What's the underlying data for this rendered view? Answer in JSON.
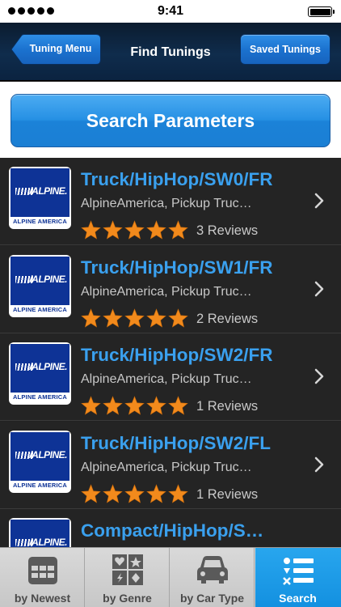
{
  "status_bar": {
    "time": "9:41"
  },
  "nav": {
    "back_label": "Tuning Menu",
    "title": "Find Tunings",
    "right_label": "Saved Tunings"
  },
  "search_button": {
    "label": "Search Parameters"
  },
  "colors": {
    "accent_blue": "#3aa0ee",
    "star_orange": "#f28a1c",
    "logo_blue": "#0e3396"
  },
  "logo": {
    "brand": "/ALPINE.",
    "subtitle": "ALPINE AMERICA"
  },
  "tunings": [
    {
      "title": "Truck/HipHop/SW0/FR",
      "subtitle": "AlpineAmerica, Pickup Truc…",
      "rating": 5,
      "reviews": "3 Reviews"
    },
    {
      "title": "Truck/HipHop/SW1/FR",
      "subtitle": "AlpineAmerica, Pickup Truc…",
      "rating": 5,
      "reviews": "2 Reviews"
    },
    {
      "title": "Truck/HipHop/SW2/FR",
      "subtitle": "AlpineAmerica, Pickup Truc…",
      "rating": 5,
      "reviews": "1 Reviews"
    },
    {
      "title": "Truck/HipHop/SW2/FL",
      "subtitle": "AlpineAmerica, Pickup Truc…",
      "rating": 5,
      "reviews": "1 Reviews"
    },
    {
      "title": "Compact/HipHop/S…",
      "subtitle": "",
      "rating": 0,
      "reviews": ""
    }
  ],
  "tabs": [
    {
      "label": "by Newest",
      "icon": "calendar-icon",
      "active": false
    },
    {
      "label": "by Genre",
      "icon": "cards-suits-icon",
      "active": false
    },
    {
      "label": "by Car Type",
      "icon": "car-icon",
      "active": false
    },
    {
      "label": "Search",
      "icon": "search-list-icon",
      "active": true
    }
  ]
}
